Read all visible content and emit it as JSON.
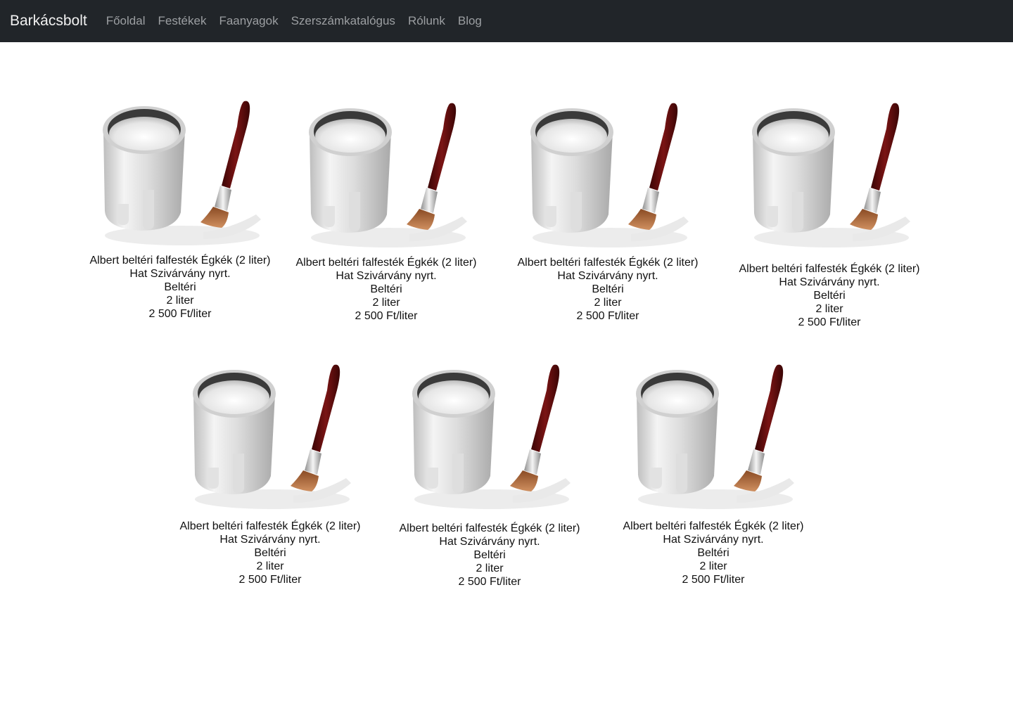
{
  "nav": {
    "brand": "Barkácsbolt",
    "links": [
      "Főoldal",
      "Festékek",
      "Faanyagok",
      "Szerszámkatalógus",
      "Rólunk",
      "Blog"
    ]
  },
  "products": [
    {
      "name": "Albert beltéri falfesték Égkék (2 liter)",
      "maker": "Hat Szivárvány nyrt.",
      "type": "Beltéri",
      "volume": "2 liter",
      "price": "2 500 Ft/liter",
      "image": "paint-can-brush-icon"
    },
    {
      "name": "Albert beltéri falfesték Égkék (2 liter)",
      "maker": "Hat Szivárvány nyrt.",
      "type": "Beltéri",
      "volume": "2 liter",
      "price": "2 500 Ft/liter",
      "image": "paint-can-brush-icon"
    },
    {
      "name": "Albert beltéri falfesték Égkék (2 liter)",
      "maker": "Hat Szivárvány nyrt.",
      "type": "Beltéri",
      "volume": "2 liter",
      "price": "2 500 Ft/liter",
      "image": "paint-can-brush-icon"
    },
    {
      "name": "Albert beltéri falfesték Égkék (2 liter)",
      "maker": "Hat Szivárvány nyrt.",
      "type": "Beltéri",
      "volume": "2 liter",
      "price": "2 500 Ft/liter",
      "image": "paint-can-brush-icon"
    },
    {
      "name": "Albert beltéri falfesték Égkék (2 liter)",
      "maker": "Hat Szivárvány nyrt.",
      "type": "Beltéri",
      "volume": "2 liter",
      "price": "2 500 Ft/liter",
      "image": "paint-can-brush-icon"
    },
    {
      "name": "Albert beltéri falfesték Égkék (2 liter)",
      "maker": "Hat Szivárvány nyrt.",
      "type": "Beltéri",
      "volume": "2 liter",
      "price": "2 500 Ft/liter",
      "image": "paint-can-brush-icon"
    },
    {
      "name": "Albert beltéri falfesték Égkék (2 liter)",
      "maker": "Hat Szivárvány nyrt.",
      "type": "Beltéri",
      "volume": "2 liter",
      "price": "2 500 Ft/liter",
      "image": "paint-can-brush-icon"
    }
  ],
  "colors": {
    "navbar": "#212529",
    "brand": "#f1f1f1",
    "nav_link": "#9c9fa2",
    "brush_handle": "#5a0a0a"
  }
}
